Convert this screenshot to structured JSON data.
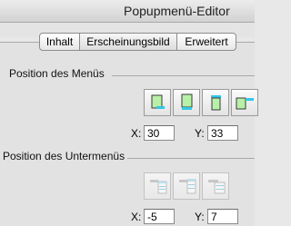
{
  "window": {
    "title": "Popupmenü-Editor"
  },
  "tabs": [
    {
      "label": "Inhalt"
    },
    {
      "label": "Erscheinungsbild"
    },
    {
      "label": "Erweitert"
    }
  ],
  "menu_position": {
    "label": "Position des Menüs",
    "x_label": "X:",
    "x_value": "30",
    "y_label": "Y:",
    "y_value": "33"
  },
  "submenu_position": {
    "label": "Position des Untermenüs",
    "x_label": "X:",
    "x_value": "-5",
    "y_label": "Y:",
    "y_value": "7"
  },
  "colors": {
    "icon_green": "#b8f0a8",
    "icon_cyan": "#34c6e8"
  }
}
